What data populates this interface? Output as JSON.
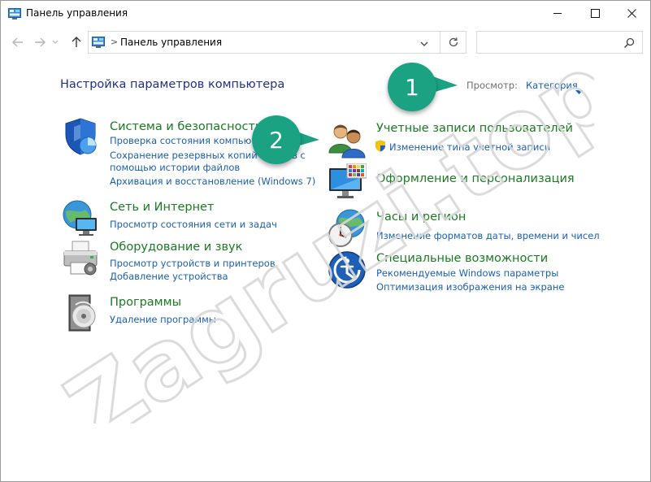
{
  "window": {
    "title": "Панель управления"
  },
  "address": {
    "location": "Панель управления",
    "search_placeholder": ""
  },
  "header": {
    "title": "Настройка параметров компьютера",
    "view_label": "Просмотр:",
    "view_value": "Категория"
  },
  "categories": {
    "system": {
      "title": "Система и безопасность",
      "links": [
        "Проверка состояния компьютера",
        "Сохранение резервных копий файлов с",
        "помощью истории файлов",
        "Архивация и восстановление (Windows 7)"
      ]
    },
    "network": {
      "title": "Сеть и Интернет",
      "links": [
        "Просмотр состояния сети и задач"
      ]
    },
    "hardware": {
      "title": "Оборудование и звук",
      "links": [
        "Просмотр устройств и принтеров",
        "Добавление устройства"
      ]
    },
    "programs": {
      "title": "Программы",
      "links": [
        "Удаление программы"
      ]
    },
    "accounts": {
      "title": "Учетные записи пользователей",
      "links": [
        "Изменение типа учетной записи"
      ]
    },
    "appearance": {
      "title": "Оформление и персонализация"
    },
    "clock": {
      "title": "Часы и регион",
      "links": [
        "Изменение форматов даты, времени и чисел"
      ]
    },
    "access": {
      "title": "Специальные возможности",
      "links": [
        "Рекомендуемые Windows параметры",
        "Оптимизация изображения на экране"
      ]
    }
  },
  "callouts": [
    "1",
    "2"
  ],
  "watermark": "Zagruzi.top",
  "colors": {
    "link": "#1a5fb4",
    "category_title": "#1a7a22",
    "page_title": "#1e3287",
    "callout": "#1aa283"
  }
}
